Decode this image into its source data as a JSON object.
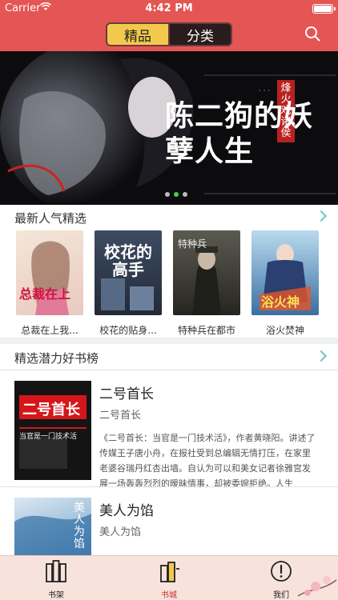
{
  "status_bar": {
    "carrier": "Carrier",
    "time": "4:42 PM"
  },
  "nav": {
    "segments": [
      {
        "label": "精品",
        "active": true
      },
      {
        "label": "分类",
        "active": false
      }
    ]
  },
  "banner": {
    "title": "陈二狗的妖孽人生",
    "badge": "烽火戏诸侯",
    "active_page": 2,
    "page_count": 3
  },
  "sections": {
    "popular": {
      "title": "最新人气精选"
    },
    "ranking": {
      "title": "精选潜力好书榜"
    }
  },
  "featured_books": [
    {
      "title": "总裁在上我...",
      "cover_text": "总裁在上"
    },
    {
      "title": "校花的贴身...",
      "cover_text": "校花的高手"
    },
    {
      "title": "特种兵在都市",
      "cover_text": "特种兵"
    },
    {
      "title": "浴火焚神",
      "cover_text": "浴火神"
    }
  ],
  "ranking_list": [
    {
      "name": "二号首长",
      "author": "二号首长",
      "cover_text": "二号首长",
      "cover_sub": "当官是一门技术活",
      "description": "《二号首长：当官是一门技术活》，作者黄晓阳。讲述了传媒王子唐小舟，在报社受到总编辑无情打压，在家里老婆谷瑞丹红杏出墙。自认为可以和美女记者徐雅宫发展一场轰轰烈烈的暧昧情事，却被委婉拒绝。人生"
    },
    {
      "name": "美人为馅",
      "author": "美人为馅",
      "cover_text": "美人为馅",
      "description": ""
    }
  ],
  "tabbar": {
    "items": [
      {
        "label": "书架",
        "active": false
      },
      {
        "label": "书城",
        "active": true
      },
      {
        "label": "我们",
        "active": false
      }
    ]
  },
  "colors": {
    "header": "#e45654",
    "accent": "#f2c94c",
    "active_tab": "#c9302c",
    "chevron": "#6cc8c0"
  }
}
